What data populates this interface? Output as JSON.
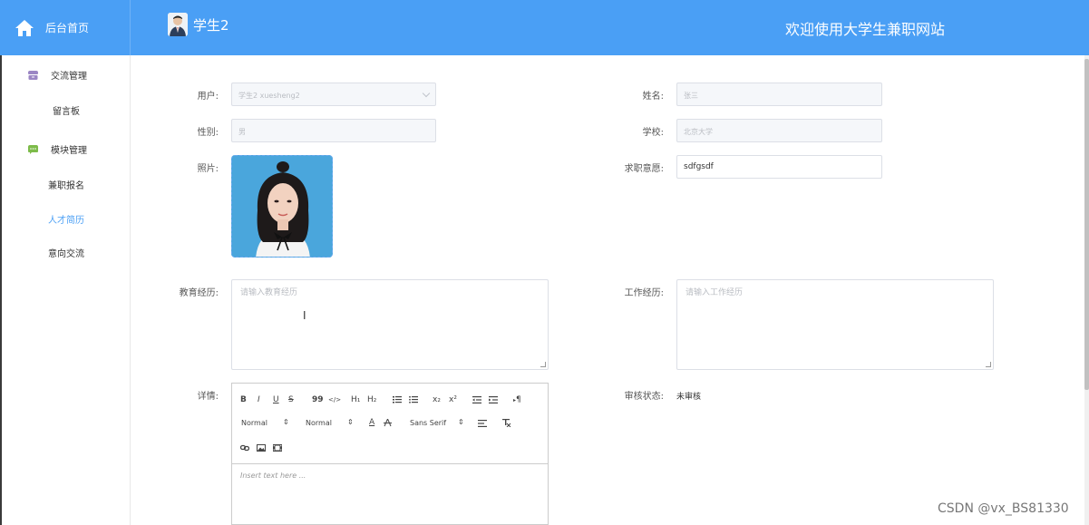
{
  "header": {
    "home_label": "后台首页",
    "user_name": "学生2",
    "welcome": "欢迎使用大学生兼职网站"
  },
  "sidebar": {
    "groups": [
      {
        "label": "交流管理",
        "icon": "archive-icon",
        "items": [
          {
            "label": "留言板"
          }
        ]
      },
      {
        "label": "模块管理",
        "icon": "chat-icon",
        "items": [
          {
            "label": "兼职报名"
          },
          {
            "label": "人才简历"
          },
          {
            "label": "意向交流"
          }
        ]
      }
    ],
    "active": "人才简历"
  },
  "form": {
    "user": {
      "label": "用户:",
      "value": "学生2 xuesheng2"
    },
    "name": {
      "label": "姓名:",
      "value": "张三"
    },
    "gender": {
      "label": "性别:",
      "value": "男"
    },
    "school": {
      "label": "学校:",
      "value": "北京大学"
    },
    "photo": {
      "label": "照片:"
    },
    "intention": {
      "label": "求职意愿:",
      "value": "sdfgsdf"
    },
    "education": {
      "label": "教育经历:",
      "placeholder": "请输入教育经历"
    },
    "work": {
      "label": "工作经历:",
      "placeholder": "请输入工作经历"
    },
    "details": {
      "label": "详情:",
      "placeholder": "Insert text here ..."
    },
    "status": {
      "label": "审核状态:",
      "value": "未审核"
    }
  },
  "editor_toolbar": {
    "bold": "B",
    "italic": "I",
    "underline": "U",
    "strike": "S",
    "quote": "99",
    "code": "</>",
    "h1": "H₁",
    "h2": "H₂",
    "sub": "x₂",
    "sup": "x²",
    "rtl": "¶",
    "size1": "Normal",
    "size2": "Normal",
    "font": "Sans Serif",
    "color": "A"
  },
  "watermark": "CSDN @vx_BS81330",
  "colors": {
    "accent": "#4a9ff5",
    "active": "#4a9ff5"
  }
}
